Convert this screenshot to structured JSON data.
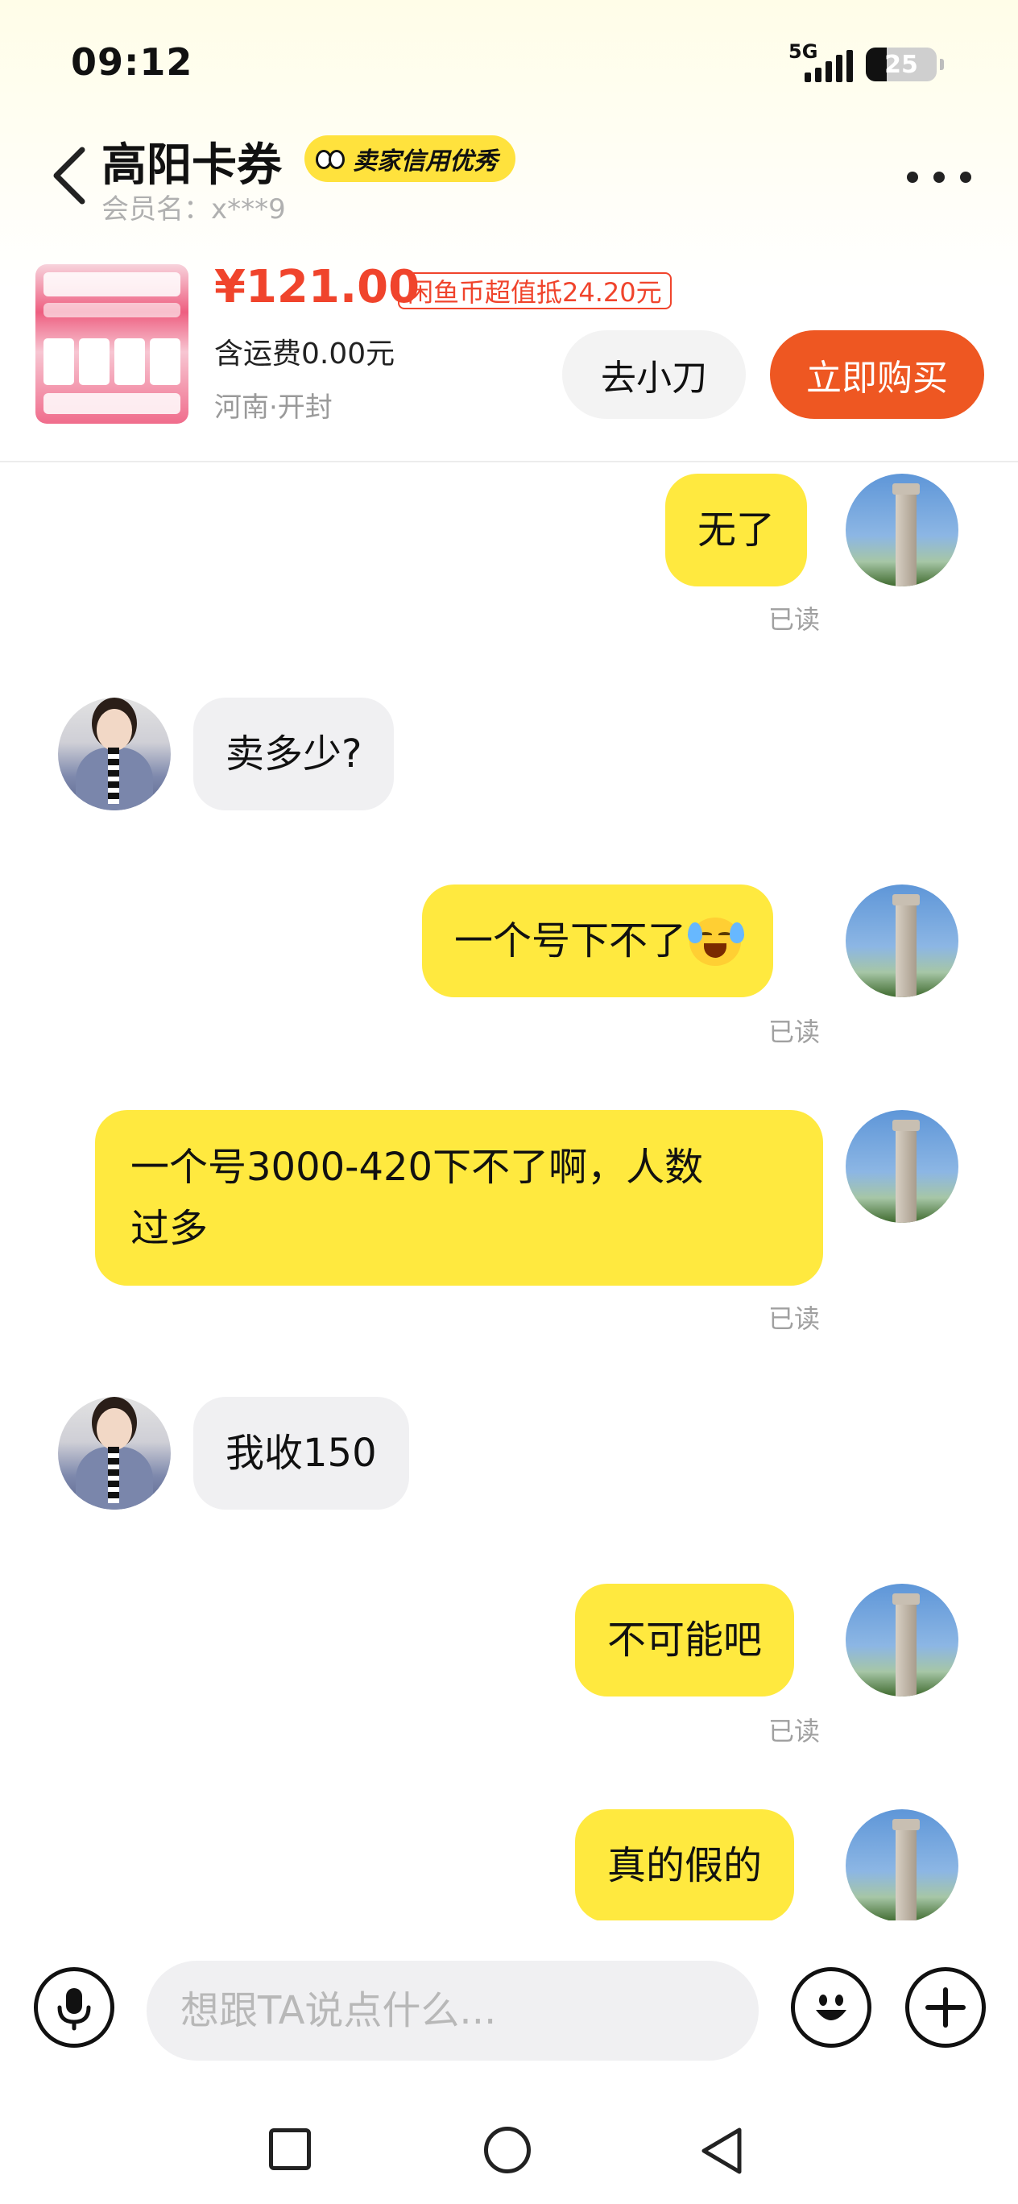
{
  "status_bar": {
    "time": "09:12",
    "network": "5G",
    "battery": "25"
  },
  "header": {
    "title": "高阳卡券",
    "seller_badge": "卖家信用优秀",
    "member_name": "会员名：x***9"
  },
  "product": {
    "price": "¥121.00",
    "coin_tag": "闲鱼币超值抵24.20元",
    "shipping": "含运费0.00元",
    "location": "河南·开封",
    "bargain_label": "去小刀",
    "buy_label": "立即购买"
  },
  "messages": [
    {
      "side": "me",
      "text": "无了",
      "status": "已读"
    },
    {
      "side": "other",
      "text": "卖多少?"
    },
    {
      "side": "me",
      "text": "一个号下不了",
      "emoji": "crying-laughing-emoji",
      "status": "已读"
    },
    {
      "side": "me",
      "text_line1": "一个号3000-420下不了啊，人数",
      "text_line2": "过多",
      "status": "已读"
    },
    {
      "side": "other",
      "text": "我收150"
    },
    {
      "side": "me",
      "text": "不可能吧",
      "status": "已读"
    },
    {
      "side": "me",
      "text": "真的假的"
    }
  ],
  "input": {
    "placeholder": "想跟TA说点什么..."
  },
  "icons": {
    "back": "back-chevron-icon",
    "more": "more-dots-icon",
    "voice": "microphone-icon",
    "emoji": "smiley-icon",
    "plus": "plus-icon"
  },
  "colors": {
    "my_bubble": "#ffe93f",
    "other_bubble": "#f0f0f2",
    "buy": "#ee5722",
    "price": "#f0442c",
    "badge": "#ffe23d"
  }
}
